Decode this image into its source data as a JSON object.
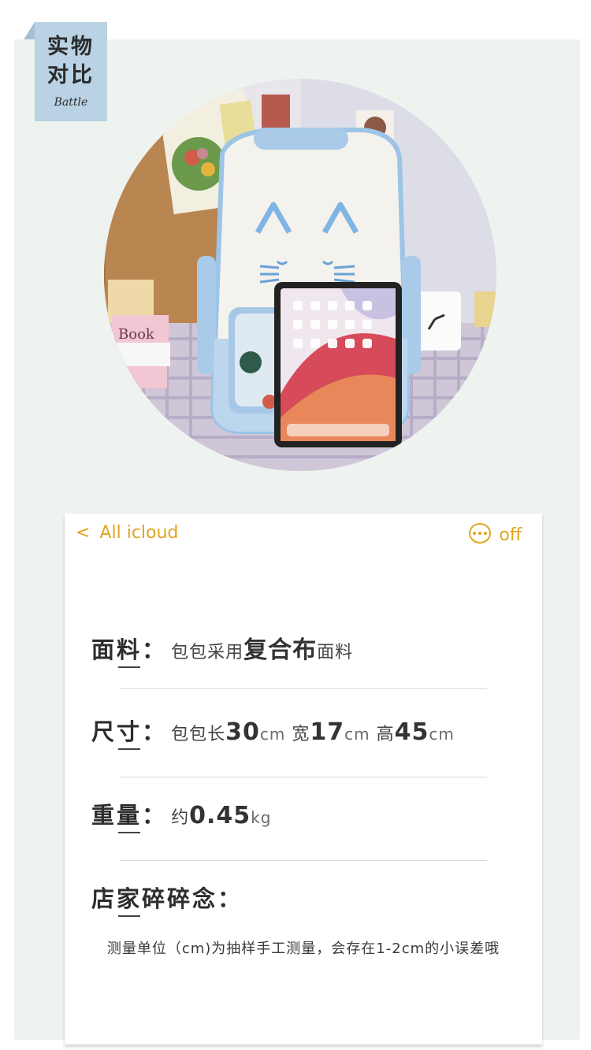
{
  "tag": {
    "line1": "实物",
    "line2": "对比",
    "sub": "Battle"
  },
  "photo": {
    "description_icon": "backpack-with-tablet-photo"
  },
  "card": {
    "header": {
      "back_label": "All icloud",
      "back_icon": "<",
      "more_label": "off"
    },
    "rows": [
      {
        "label_a": "面",
        "label_b": "料",
        "sep": "：",
        "val1": "包包采用",
        "val2": "复合布",
        "val3": "面料"
      },
      {
        "label_a": "尺",
        "label_b": "寸",
        "sep": "：",
        "val1": "包包长",
        "val2": "30",
        "val3": "cm",
        "val4": "宽",
        "val5": "17",
        "val6": "cm",
        "val7": "高",
        "val8": "45",
        "val9": "cm"
      },
      {
        "label_a": "重",
        "label_b": "量",
        "sep": "：",
        "val1": "约",
        "val2": "0.45",
        "val3": "kg"
      },
      {
        "label_a": "店",
        "label_b": "家",
        "label_c": "碎碎念",
        "sep": "："
      }
    ],
    "note": "测量单位（cm)为抽样手工测量，会存在1-2cm的小误差哦"
  },
  "colors": {
    "accent": "#e0a51f",
    "tag_bg": "#b9d2e4",
    "panel_bg": "#eef3f0"
  }
}
